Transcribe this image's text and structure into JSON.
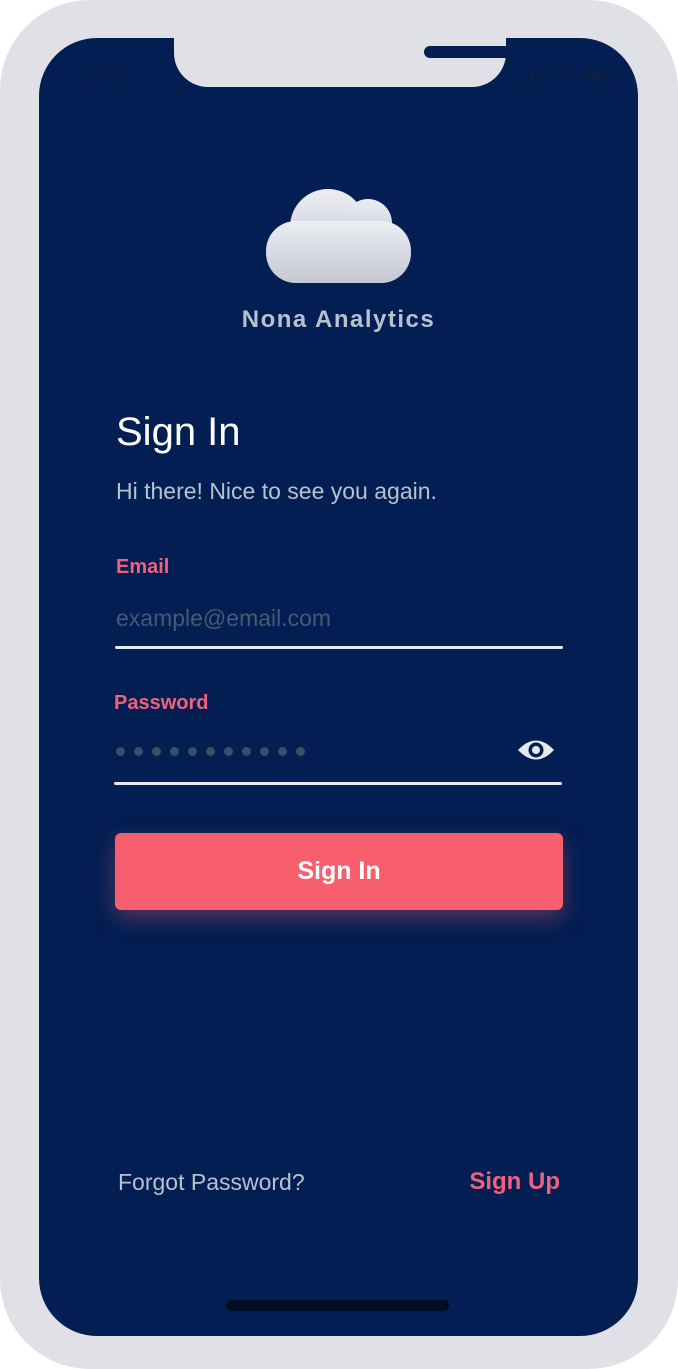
{
  "status_bar": {
    "time": "9:31",
    "icons": [
      "signal-icon",
      "wifi-icon",
      "battery-icon"
    ]
  },
  "brand": {
    "logo_icon": "cloud-icon",
    "name": "Nona Analytics"
  },
  "signin": {
    "title": "Sign In",
    "subtitle": "Hi there! Nice to see you again."
  },
  "form": {
    "email_label": "Email",
    "email_placeholder": "example@email.com",
    "email_value": "",
    "password_label": "Password",
    "password_masked_length": 11,
    "password_toggle_icon": "eye-icon"
  },
  "actions": {
    "submit_label": "Sign In",
    "forgot_label": "Forgot Password?",
    "signup_label": "Sign Up"
  },
  "colors": {
    "background": "#021e52",
    "accent": "#f75e6e",
    "frame": "#dfe1e6",
    "muted_text": "#b9c1cf"
  }
}
